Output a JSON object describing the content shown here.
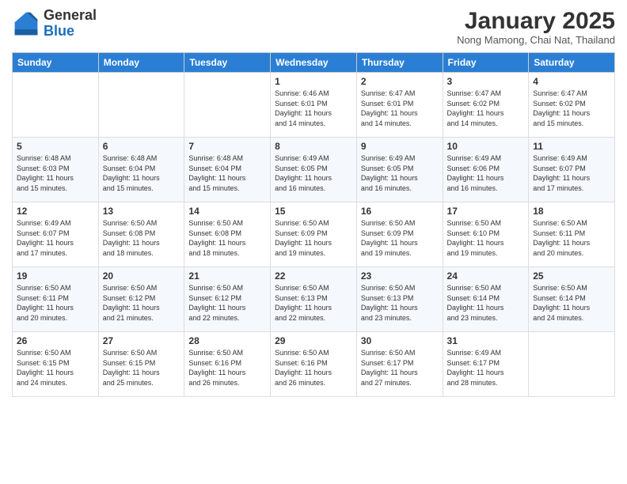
{
  "header": {
    "logo_general": "General",
    "logo_blue": "Blue",
    "month_title": "January 2025",
    "location": "Nong Mamong, Chai Nat, Thailand"
  },
  "days_of_week": [
    "Sunday",
    "Monday",
    "Tuesday",
    "Wednesday",
    "Thursday",
    "Friday",
    "Saturday"
  ],
  "weeks": [
    [
      {
        "day": "",
        "info": ""
      },
      {
        "day": "",
        "info": ""
      },
      {
        "day": "",
        "info": ""
      },
      {
        "day": "1",
        "info": "Sunrise: 6:46 AM\nSunset: 6:01 PM\nDaylight: 11 hours\nand 14 minutes."
      },
      {
        "day": "2",
        "info": "Sunrise: 6:47 AM\nSunset: 6:01 PM\nDaylight: 11 hours\nand 14 minutes."
      },
      {
        "day": "3",
        "info": "Sunrise: 6:47 AM\nSunset: 6:02 PM\nDaylight: 11 hours\nand 14 minutes."
      },
      {
        "day": "4",
        "info": "Sunrise: 6:47 AM\nSunset: 6:02 PM\nDaylight: 11 hours\nand 15 minutes."
      }
    ],
    [
      {
        "day": "5",
        "info": "Sunrise: 6:48 AM\nSunset: 6:03 PM\nDaylight: 11 hours\nand 15 minutes."
      },
      {
        "day": "6",
        "info": "Sunrise: 6:48 AM\nSunset: 6:04 PM\nDaylight: 11 hours\nand 15 minutes."
      },
      {
        "day": "7",
        "info": "Sunrise: 6:48 AM\nSunset: 6:04 PM\nDaylight: 11 hours\nand 15 minutes."
      },
      {
        "day": "8",
        "info": "Sunrise: 6:49 AM\nSunset: 6:05 PM\nDaylight: 11 hours\nand 16 minutes."
      },
      {
        "day": "9",
        "info": "Sunrise: 6:49 AM\nSunset: 6:05 PM\nDaylight: 11 hours\nand 16 minutes."
      },
      {
        "day": "10",
        "info": "Sunrise: 6:49 AM\nSunset: 6:06 PM\nDaylight: 11 hours\nand 16 minutes."
      },
      {
        "day": "11",
        "info": "Sunrise: 6:49 AM\nSunset: 6:07 PM\nDaylight: 11 hours\nand 17 minutes."
      }
    ],
    [
      {
        "day": "12",
        "info": "Sunrise: 6:49 AM\nSunset: 6:07 PM\nDaylight: 11 hours\nand 17 minutes."
      },
      {
        "day": "13",
        "info": "Sunrise: 6:50 AM\nSunset: 6:08 PM\nDaylight: 11 hours\nand 18 minutes."
      },
      {
        "day": "14",
        "info": "Sunrise: 6:50 AM\nSunset: 6:08 PM\nDaylight: 11 hours\nand 18 minutes."
      },
      {
        "day": "15",
        "info": "Sunrise: 6:50 AM\nSunset: 6:09 PM\nDaylight: 11 hours\nand 19 minutes."
      },
      {
        "day": "16",
        "info": "Sunrise: 6:50 AM\nSunset: 6:09 PM\nDaylight: 11 hours\nand 19 minutes."
      },
      {
        "day": "17",
        "info": "Sunrise: 6:50 AM\nSunset: 6:10 PM\nDaylight: 11 hours\nand 19 minutes."
      },
      {
        "day": "18",
        "info": "Sunrise: 6:50 AM\nSunset: 6:11 PM\nDaylight: 11 hours\nand 20 minutes."
      }
    ],
    [
      {
        "day": "19",
        "info": "Sunrise: 6:50 AM\nSunset: 6:11 PM\nDaylight: 11 hours\nand 20 minutes."
      },
      {
        "day": "20",
        "info": "Sunrise: 6:50 AM\nSunset: 6:12 PM\nDaylight: 11 hours\nand 21 minutes."
      },
      {
        "day": "21",
        "info": "Sunrise: 6:50 AM\nSunset: 6:12 PM\nDaylight: 11 hours\nand 22 minutes."
      },
      {
        "day": "22",
        "info": "Sunrise: 6:50 AM\nSunset: 6:13 PM\nDaylight: 11 hours\nand 22 minutes."
      },
      {
        "day": "23",
        "info": "Sunrise: 6:50 AM\nSunset: 6:13 PM\nDaylight: 11 hours\nand 23 minutes."
      },
      {
        "day": "24",
        "info": "Sunrise: 6:50 AM\nSunset: 6:14 PM\nDaylight: 11 hours\nand 23 minutes."
      },
      {
        "day": "25",
        "info": "Sunrise: 6:50 AM\nSunset: 6:14 PM\nDaylight: 11 hours\nand 24 minutes."
      }
    ],
    [
      {
        "day": "26",
        "info": "Sunrise: 6:50 AM\nSunset: 6:15 PM\nDaylight: 11 hours\nand 24 minutes."
      },
      {
        "day": "27",
        "info": "Sunrise: 6:50 AM\nSunset: 6:15 PM\nDaylight: 11 hours\nand 25 minutes."
      },
      {
        "day": "28",
        "info": "Sunrise: 6:50 AM\nSunset: 6:16 PM\nDaylight: 11 hours\nand 26 minutes."
      },
      {
        "day": "29",
        "info": "Sunrise: 6:50 AM\nSunset: 6:16 PM\nDaylight: 11 hours\nand 26 minutes."
      },
      {
        "day": "30",
        "info": "Sunrise: 6:50 AM\nSunset: 6:17 PM\nDaylight: 11 hours\nand 27 minutes."
      },
      {
        "day": "31",
        "info": "Sunrise: 6:49 AM\nSunset: 6:17 PM\nDaylight: 11 hours\nand 28 minutes."
      },
      {
        "day": "",
        "info": ""
      }
    ]
  ]
}
